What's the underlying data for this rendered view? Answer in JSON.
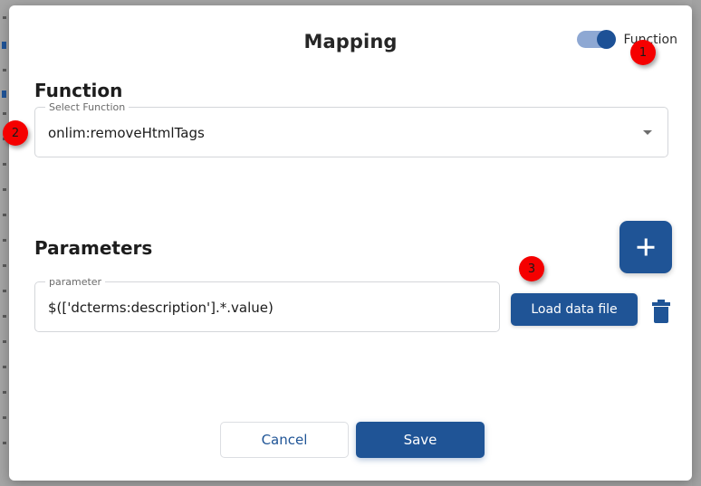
{
  "dialog": {
    "title": "Mapping",
    "toggle": {
      "label": "Function",
      "state": "on",
      "icon": "toggle-switch-icon"
    },
    "function_section": {
      "heading": "Function",
      "select": {
        "label": "Select Function",
        "value": "onlim:removeHtmlTags",
        "caret_icon": "chevron-down-icon"
      }
    },
    "parameters_section": {
      "heading": "Parameters",
      "add_button": {
        "icon": "plus-icon",
        "label": "+"
      },
      "parameter_field": {
        "label": "parameter",
        "value": "$(['dcterms:description'].*.value)"
      },
      "load_data_file_button": "Load data file",
      "delete_button": {
        "icon": "trash-icon"
      }
    },
    "footer": {
      "cancel_label": "Cancel",
      "save_label": "Save"
    }
  },
  "annotations": [
    {
      "number": "1",
      "target": "function-toggle"
    },
    {
      "number": "2",
      "target": "select-function-field"
    },
    {
      "number": "3",
      "target": "load-data-file-button"
    }
  ],
  "colors": {
    "primary_blue": "#1f5496",
    "toggle_track": "#8ea8d3",
    "badge_red": "#f50000",
    "field_border": "#d4d6da",
    "backdrop_gray": "#a6a6a6"
  }
}
